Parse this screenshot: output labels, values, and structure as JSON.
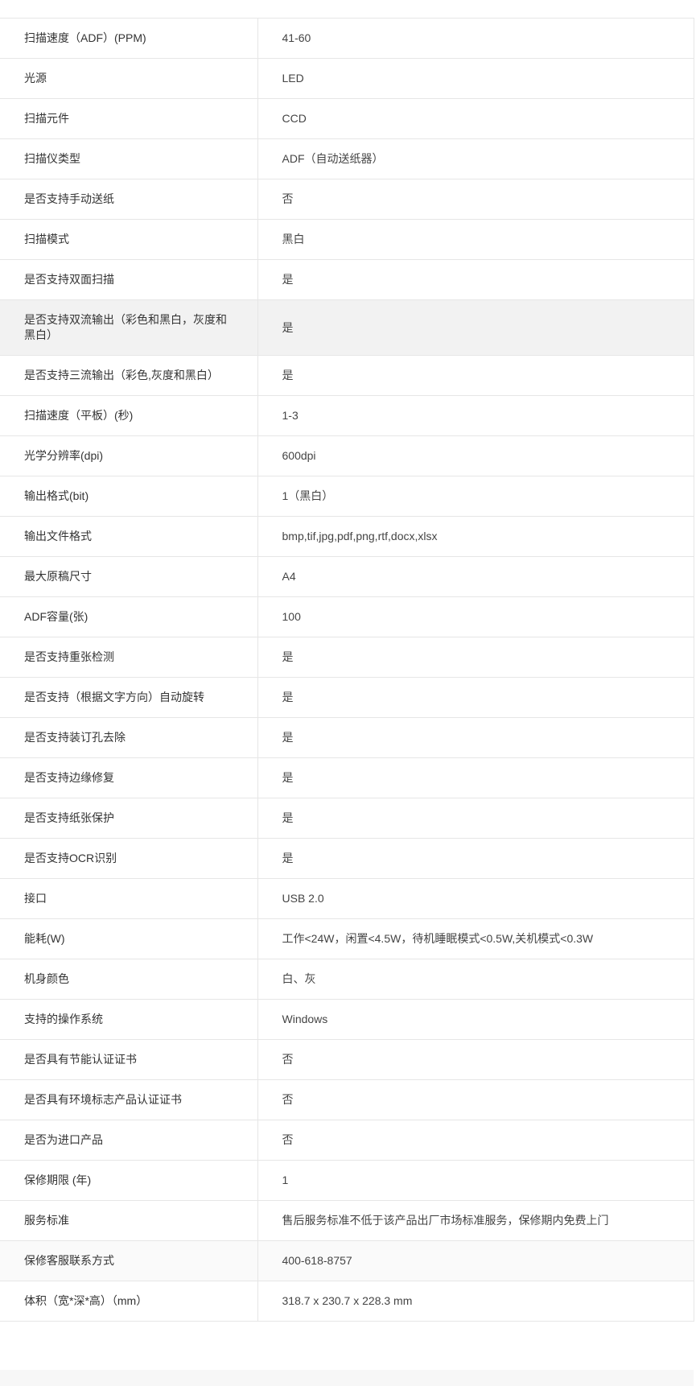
{
  "spec_rows": [
    {
      "key": "扫描速度（ADF）(PPM)",
      "value": "41-60"
    },
    {
      "key": "光源",
      "value": "LED"
    },
    {
      "key": "扫描元件",
      "value": "CCD"
    },
    {
      "key": "扫描仪类型",
      "value": "ADF（自动送纸器）"
    },
    {
      "key": "是否支持手动送纸",
      "value": "否"
    },
    {
      "key": "扫描模式",
      "value": "黑白"
    },
    {
      "key": "是否支持双面扫描",
      "value": "是"
    },
    {
      "key": "是否支持双流输出（彩色和黑白，灰度和黑白）",
      "value": "是"
    },
    {
      "key": "是否支持三流输出（彩色,灰度和黑白）",
      "value": "是"
    },
    {
      "key": "扫描速度（平板）(秒)",
      "value": "1-3"
    },
    {
      "key": "光学分辨率(dpi)",
      "value": "600dpi"
    },
    {
      "key": "输出格式(bit)",
      "value": "1（黑白）"
    },
    {
      "key": "输出文件格式",
      "value": "bmp,tif,jpg,pdf,png,rtf,docx,xlsx"
    },
    {
      "key": "最大原稿尺寸",
      "value": "A4"
    },
    {
      "key": "ADF容量(张)",
      "value": "100"
    },
    {
      "key": "是否支持重张检测",
      "value": "是"
    },
    {
      "key": "是否支持（根据文字方向）自动旋转",
      "value": "是"
    },
    {
      "key": "是否支持装订孔去除",
      "value": "是"
    },
    {
      "key": "是否支持边缘修复",
      "value": "是"
    },
    {
      "key": "是否支持纸张保护",
      "value": "是"
    },
    {
      "key": "是否支持OCR识别",
      "value": "是"
    },
    {
      "key": "接口",
      "value": "USB 2.0"
    },
    {
      "key": "能耗(W)",
      "value": "工作<24W，闲置<4.5W，待机睡眠模式<0.5W,关机模式<0.3W"
    },
    {
      "key": "机身颜色",
      "value": "白、灰"
    },
    {
      "key": "支持的操作系统",
      "value": "Windows"
    },
    {
      "key": "是否具有节能认证证书",
      "value": "否"
    },
    {
      "key": "是否具有环境标志产品认证证书",
      "value": "否"
    },
    {
      "key": "是否为进口产品",
      "value": "否"
    },
    {
      "key": "保修期限 (年)",
      "value": "1"
    },
    {
      "key": "服务标准",
      "value": "售后服务标准不低于该产品出厂市场标准服务，保修期内免费上门"
    },
    {
      "key": "保修客服联系方式",
      "value": "400-618-8757"
    },
    {
      "key": "体积（宽*深*高）（mm）",
      "value": "318.7 x 230.7 x 228.3 mm"
    }
  ]
}
